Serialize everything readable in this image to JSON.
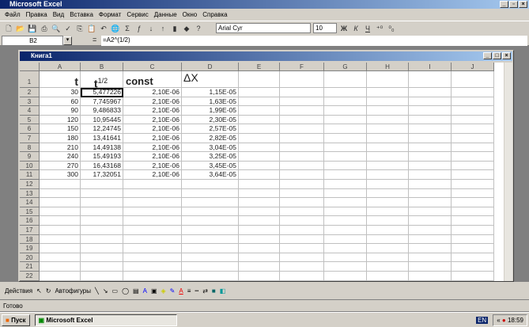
{
  "app_title": "Microsoft Excel",
  "menu": [
    "Файл",
    "Правка",
    "Вид",
    "Вставка",
    "Формат",
    "Сервис",
    "Данные",
    "Окно",
    "Справка"
  ],
  "toolbar": {
    "icons": [
      "new-icon",
      "open-icon",
      "save-icon",
      "print-icon",
      "print-preview-icon",
      "spelling-icon",
      "copy-icon",
      "paste-icon",
      "undo-icon",
      "web-icon",
      "autosum-icon",
      "function-icon",
      "sort-asc-icon",
      "sort-desc-icon",
      "chart-icon",
      "drawing-icon",
      "help-icon"
    ],
    "font": "Arial Cyr",
    "size": "10",
    "bold": "Ж",
    "italic": "К",
    "underline": "Ч"
  },
  "formula": {
    "name_box": "B2",
    "eq": "=",
    "value": "=A2^(1/2)"
  },
  "workbook": {
    "title": "Книга1"
  },
  "columns": [
    "A",
    "B",
    "C",
    "D",
    "E",
    "F",
    "G",
    "H",
    "I",
    "J"
  ],
  "headers": {
    "A": "t",
    "B": "t",
    "B_sup": "1/2",
    "C": "const",
    "D": "ΔX"
  },
  "rows": [
    [
      "30",
      "5,477226",
      "2,10E-06",
      "1,15E-05"
    ],
    [
      "60",
      "7,745967",
      "2,10E-06",
      "1,63E-05"
    ],
    [
      "90",
      "9,486833",
      "2,10E-06",
      "1,99E-05"
    ],
    [
      "120",
      "10,95445",
      "2,10E-06",
      "2,30E-05"
    ],
    [
      "150",
      "12,24745",
      "2,10E-06",
      "2,57E-05"
    ],
    [
      "180",
      "13,41641",
      "2,10E-06",
      "2,82E-05"
    ],
    [
      "210",
      "14,49138",
      "2,10E-06",
      "3,04E-05"
    ],
    [
      "240",
      "15,49193",
      "2,10E-06",
      "3,25E-05"
    ],
    [
      "270",
      "16,43168",
      "2,10E-06",
      "3,45E-05"
    ],
    [
      "300",
      "17,32051",
      "2,10E-06",
      "3,64E-05"
    ]
  ],
  "row_count": 22,
  "drawing": {
    "actions": "Действия",
    "autoshapes": "Автофигуры"
  },
  "status": "Готово",
  "taskbar": {
    "start": "Пуск",
    "task": "Microsoft Excel",
    "lang": "EN",
    "time": "18:59"
  }
}
